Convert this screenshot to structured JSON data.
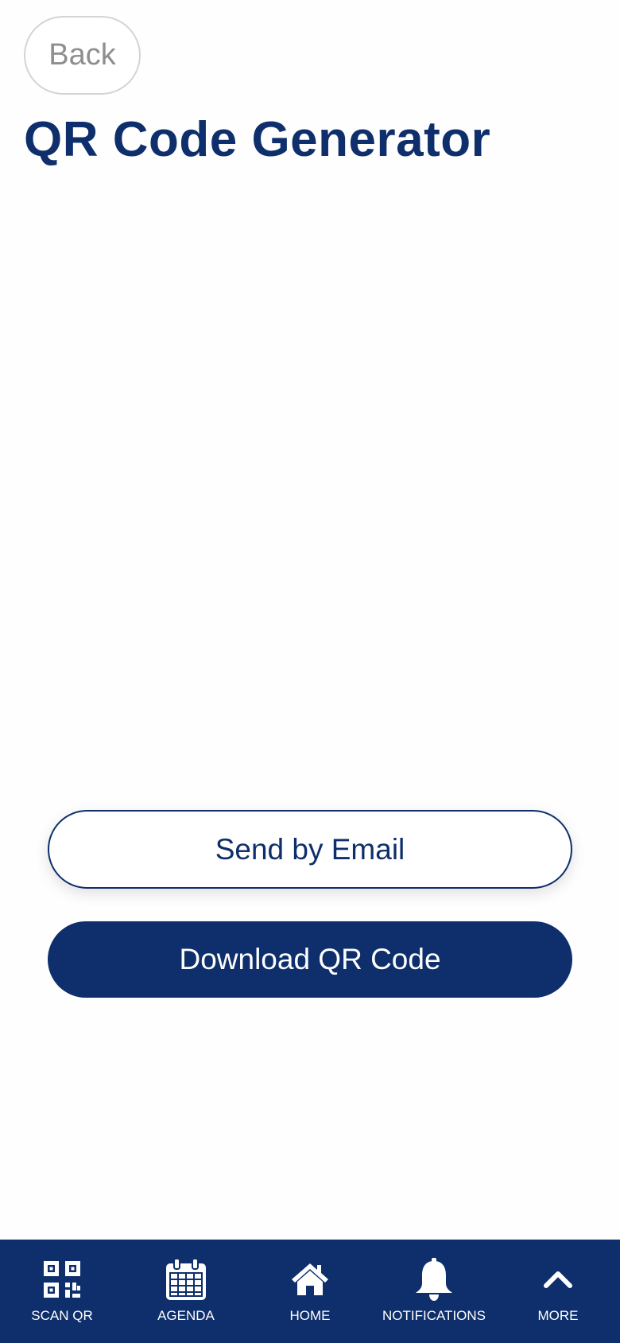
{
  "header": {
    "back_label": "Back",
    "title": "QR Code Generator"
  },
  "actions": {
    "email_label": "Send by Email",
    "download_label": "Download QR Code"
  },
  "tab_bar": {
    "items": [
      {
        "label": "SCAN QR",
        "icon": "qr-code-icon"
      },
      {
        "label": "AGENDA",
        "icon": "calendar-icon"
      },
      {
        "label": "HOME",
        "icon": "home-icon"
      },
      {
        "label": "NOTIFICATIONS",
        "icon": "bell-icon"
      },
      {
        "label": "MORE",
        "icon": "chevron-up-icon"
      }
    ]
  },
  "colors": {
    "primary": "#0e2f6c",
    "background": "#fefefe",
    "back_text": "#8e8e8e",
    "back_border": "#d4d4d4"
  }
}
